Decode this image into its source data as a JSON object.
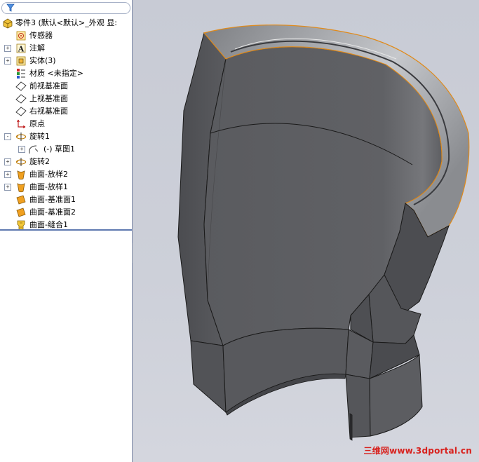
{
  "filter": {
    "icon": "filter-icon"
  },
  "tree": {
    "root": {
      "label": "零件3  (默认<默认>_外观 显:",
      "icon": "part-icon"
    },
    "items": [
      {
        "label": "传感器",
        "icon": "sensor-icon",
        "expander": ""
      },
      {
        "label": "注解",
        "icon": "annotation-icon",
        "expander": "+"
      },
      {
        "label": "实体(3)",
        "icon": "solid-bodies-icon",
        "expander": "+"
      },
      {
        "label": "材质 <未指定>",
        "icon": "material-icon",
        "expander": ""
      },
      {
        "label": "前视基准面",
        "icon": "plane-icon",
        "expander": ""
      },
      {
        "label": "上视基准面",
        "icon": "plane-icon",
        "expander": ""
      },
      {
        "label": "右视基准面",
        "icon": "plane-icon",
        "expander": ""
      },
      {
        "label": "原点",
        "icon": "origin-icon",
        "expander": ""
      },
      {
        "label": "旋转1",
        "icon": "revolve-icon",
        "expander": "-"
      },
      {
        "label": "(-) 草图1",
        "icon": "sketch-icon",
        "expander": "+"
      },
      {
        "label": "旋转2",
        "icon": "revolve-icon",
        "expander": "+"
      },
      {
        "label": "曲面-放样2",
        "icon": "surface-loft-icon",
        "expander": "+"
      },
      {
        "label": "曲面-放样1",
        "icon": "surface-loft-icon",
        "expander": "+"
      },
      {
        "label": "曲面-基准面1",
        "icon": "planar-surface-icon",
        "expander": ""
      },
      {
        "label": "曲面-基准面2",
        "icon": "planar-surface-icon",
        "expander": ""
      },
      {
        "label": "曲面-缝合1",
        "icon": "surface-knit-icon",
        "expander": ""
      }
    ]
  },
  "viewport": {
    "watermark": "三维网www.3dportal.cn"
  },
  "colors": {
    "model_face": "#5c5d61",
    "highlight_edge": "#e08a1a",
    "tree_bg": "#ffffff"
  }
}
